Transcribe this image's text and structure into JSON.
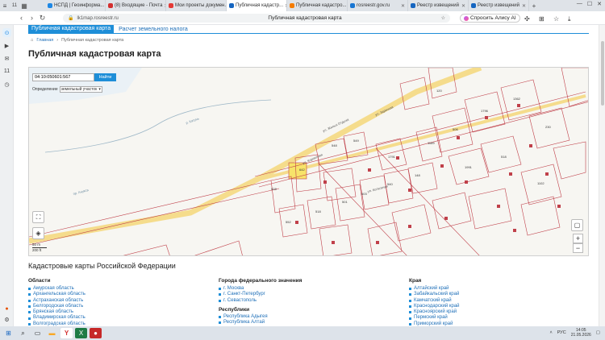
{
  "browser": {
    "tabs": [
      {
        "label": "НСПД | Геоинформа...",
        "color": "#1e88e5"
      },
      {
        "label": "(8) Входящие - Почта",
        "color": "#d32f2f"
      },
      {
        "label": "Мои проекты докумен...",
        "color": "#e53935"
      },
      {
        "label": "Публичная кадастр...",
        "color": "#1565c0",
        "active": true
      },
      {
        "label": "Публичная кадастро...",
        "color": "#f57c00"
      },
      {
        "label": "rosreestr.gov.ru",
        "color": "#1976d2"
      },
      {
        "label": "Реестр извещений",
        "color": "#1565c0"
      },
      {
        "label": "Реестр извещений",
        "color": "#1565c0"
      }
    ],
    "tab_bar_left_label": "11",
    "url": "lk1map.rosreestr.ru",
    "page_title": "Публичная кадастровая карта",
    "alice_label": "Спросить Алису AI"
  },
  "site": {
    "tab_active": "Публичная кадастровая карта",
    "tab_other": "Расчет земельного налога",
    "breadcrumb": {
      "home": "Главная",
      "current": "Публичная кадастровая карта"
    },
    "heading": "Публичная кадастровая карта"
  },
  "map": {
    "search_value": "04:10:050601:567",
    "search_button": "Найти",
    "define_label": "Определение",
    "define_option": "земельный участок",
    "scale_top": "50 m",
    "scale_bottom": "200 ft",
    "zoom_in": "+",
    "zoom_out": "−",
    "street_1": "ул. Заречная",
    "street_2": "ул. Жилых Отдыха",
    "street_3": "ул. Корнилова",
    "street_4": "ул. Колхозная",
    "street_5": "пр. Анукса",
    "river": "р. Катунь",
    "parcels": [
      "120",
      "548",
      "549",
      "642",
      "528",
      "552",
      "518",
      "501",
      "503",
      "540",
      "148",
      "506",
      "1169",
      "1791",
      "1796",
      "1362",
      "230",
      "1991",
      "518",
      "1102"
    ]
  },
  "lists": {
    "heading": "Кадастровые карты Российской Федерации",
    "col1": {
      "title": "Области",
      "items": [
        "Амурская область",
        "Архангельская область",
        "Астраханская область",
        "Белгородская область",
        "Брянская область",
        "Владимирская область",
        "Волгоградская область"
      ]
    },
    "col2": {
      "title": "Города федерального значения",
      "items": [
        "г. Москва",
        "г. Санкт-Петербург",
        "г. Севастополь"
      ],
      "sub_title": "Республики",
      "sub_items": [
        "Республика Адыгея",
        "Республика Алтай"
      ]
    },
    "col3": {
      "title": "Края",
      "items": [
        "Алтайский край",
        "Забайкальский край",
        "Камчатский край",
        "Краснодарский край",
        "Красноярский край",
        "Пермский край",
        "Приморский край"
      ]
    }
  },
  "taskbar": {
    "tray_lang": "РУС",
    "time": "14:05",
    "date": "21.05.2026"
  },
  "colors": {
    "accent": "#1e8ed8",
    "parcel_line": "#c0404a",
    "road": "#f5dc8c"
  }
}
